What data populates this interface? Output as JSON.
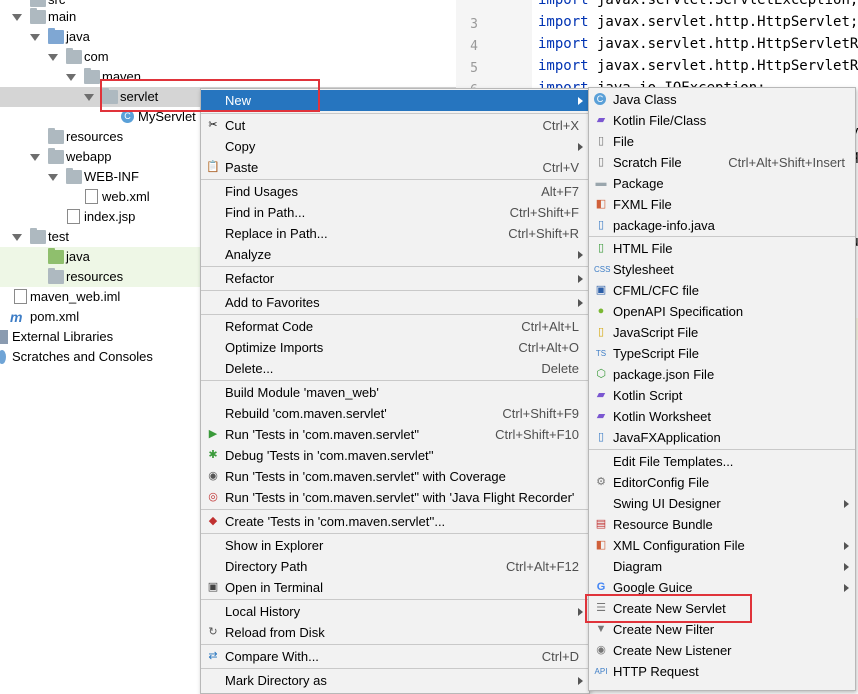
{
  "editor": {
    "line_numbers": [
      "3",
      "4",
      "5",
      "6"
    ],
    "lines": [
      {
        "kw": "import",
        "rest": " javax.servlet.ServletException;"
      },
      {
        "kw": "import",
        "rest": " javax.servlet.http.HttpServlet;"
      },
      {
        "kw": "import",
        "rest": " javax.servlet.http.HttpServletReq"
      },
      {
        "kw": "import",
        "rest": " javax.servlet.http.HttpServletRes"
      },
      {
        "kw": "import",
        "rest": " java.io.IOException;"
      }
    ],
    "frag1": "ly",
    "frag2": "eq",
    "frag3": "qu"
  },
  "tree": {
    "items": [
      {
        "label": "src"
      },
      {
        "label": "main"
      },
      {
        "label": "java"
      },
      {
        "label": "com"
      },
      {
        "label": "maven"
      },
      {
        "label": "servlet"
      },
      {
        "label": "MyServlet"
      },
      {
        "label": "resources"
      },
      {
        "label": "webapp"
      },
      {
        "label": "WEB-INF"
      },
      {
        "label": "web.xml"
      },
      {
        "label": "index.jsp"
      },
      {
        "label": "test"
      },
      {
        "label": "java"
      },
      {
        "label": "resources"
      },
      {
        "label": "maven_web.iml"
      },
      {
        "label": "pom.xml"
      },
      {
        "label": "External Libraries"
      },
      {
        "label": "Scratches and Consoles"
      }
    ]
  },
  "context_menu": {
    "items": [
      {
        "label": "New",
        "shortcut": ""
      },
      {
        "label": "Cut",
        "shortcut": "Ctrl+X"
      },
      {
        "label": "Copy",
        "shortcut": ""
      },
      {
        "label": "Paste",
        "shortcut": "Ctrl+V"
      },
      {
        "label": "Find Usages",
        "shortcut": "Alt+F7"
      },
      {
        "label": "Find in Path...",
        "shortcut": "Ctrl+Shift+F"
      },
      {
        "label": "Replace in Path...",
        "shortcut": "Ctrl+Shift+R"
      },
      {
        "label": "Analyze",
        "shortcut": ""
      },
      {
        "label": "Refactor",
        "shortcut": ""
      },
      {
        "label": "Add to Favorites",
        "shortcut": ""
      },
      {
        "label": "Reformat Code",
        "shortcut": "Ctrl+Alt+L"
      },
      {
        "label": "Optimize Imports",
        "shortcut": "Ctrl+Alt+O"
      },
      {
        "label": "Delete...",
        "shortcut": "Delete"
      },
      {
        "label": "Build Module 'maven_web'",
        "shortcut": ""
      },
      {
        "label": "Rebuild 'com.maven.servlet'",
        "shortcut": "Ctrl+Shift+F9"
      },
      {
        "label": "Run 'Tests in 'com.maven.servlet''",
        "shortcut": "Ctrl+Shift+F10"
      },
      {
        "label": "Debug 'Tests in 'com.maven.servlet''",
        "shortcut": ""
      },
      {
        "label": "Run 'Tests in 'com.maven.servlet'' with Coverage",
        "shortcut": ""
      },
      {
        "label": "Run 'Tests in 'com.maven.servlet'' with 'Java Flight Recorder'",
        "shortcut": ""
      },
      {
        "label": "Create 'Tests in 'com.maven.servlet''...",
        "shortcut": ""
      },
      {
        "label": "Show in Explorer",
        "shortcut": ""
      },
      {
        "label": "Directory Path",
        "shortcut": "Ctrl+Alt+F12"
      },
      {
        "label": "Open in Terminal",
        "shortcut": ""
      },
      {
        "label": "Local History",
        "shortcut": ""
      },
      {
        "label": "Reload from Disk",
        "shortcut": ""
      },
      {
        "label": "Compare With...",
        "shortcut": "Ctrl+D"
      },
      {
        "label": "Mark Directory as",
        "shortcut": ""
      }
    ]
  },
  "new_submenu": {
    "items": [
      {
        "label": "Java Class",
        "shortcut": ""
      },
      {
        "label": "Kotlin File/Class",
        "shortcut": ""
      },
      {
        "label": "File",
        "shortcut": ""
      },
      {
        "label": "Scratch File",
        "shortcut": "Ctrl+Alt+Shift+Insert"
      },
      {
        "label": "Package",
        "shortcut": ""
      },
      {
        "label": "FXML File",
        "shortcut": ""
      },
      {
        "label": "package-info.java",
        "shortcut": ""
      },
      {
        "label": "HTML File",
        "shortcut": ""
      },
      {
        "label": "Stylesheet",
        "shortcut": ""
      },
      {
        "label": "CFML/CFC file",
        "shortcut": ""
      },
      {
        "label": "OpenAPI Specification",
        "shortcut": ""
      },
      {
        "label": "JavaScript File",
        "shortcut": ""
      },
      {
        "label": "TypeScript File",
        "shortcut": ""
      },
      {
        "label": "package.json File",
        "shortcut": ""
      },
      {
        "label": "Kotlin Script",
        "shortcut": ""
      },
      {
        "label": "Kotlin Worksheet",
        "shortcut": ""
      },
      {
        "label": "JavaFXApplication",
        "shortcut": ""
      },
      {
        "label": "Edit File Templates...",
        "shortcut": ""
      },
      {
        "label": "EditorConfig File",
        "shortcut": ""
      },
      {
        "label": "Swing UI Designer",
        "shortcut": ""
      },
      {
        "label": "Resource Bundle",
        "shortcut": ""
      },
      {
        "label": "XML Configuration File",
        "shortcut": ""
      },
      {
        "label": "Diagram",
        "shortcut": ""
      },
      {
        "label": "Google Guice",
        "shortcut": ""
      },
      {
        "label": "Create New Servlet",
        "shortcut": ""
      },
      {
        "label": "Create New Filter",
        "shortcut": ""
      },
      {
        "label": "Create New Listener",
        "shortcut": ""
      },
      {
        "label": "HTTP Request",
        "shortcut": ""
      }
    ]
  },
  "colors": {
    "highlight": "#2675bf",
    "annotation": "#e0333a",
    "menu_bg": "#f2f2f2"
  }
}
